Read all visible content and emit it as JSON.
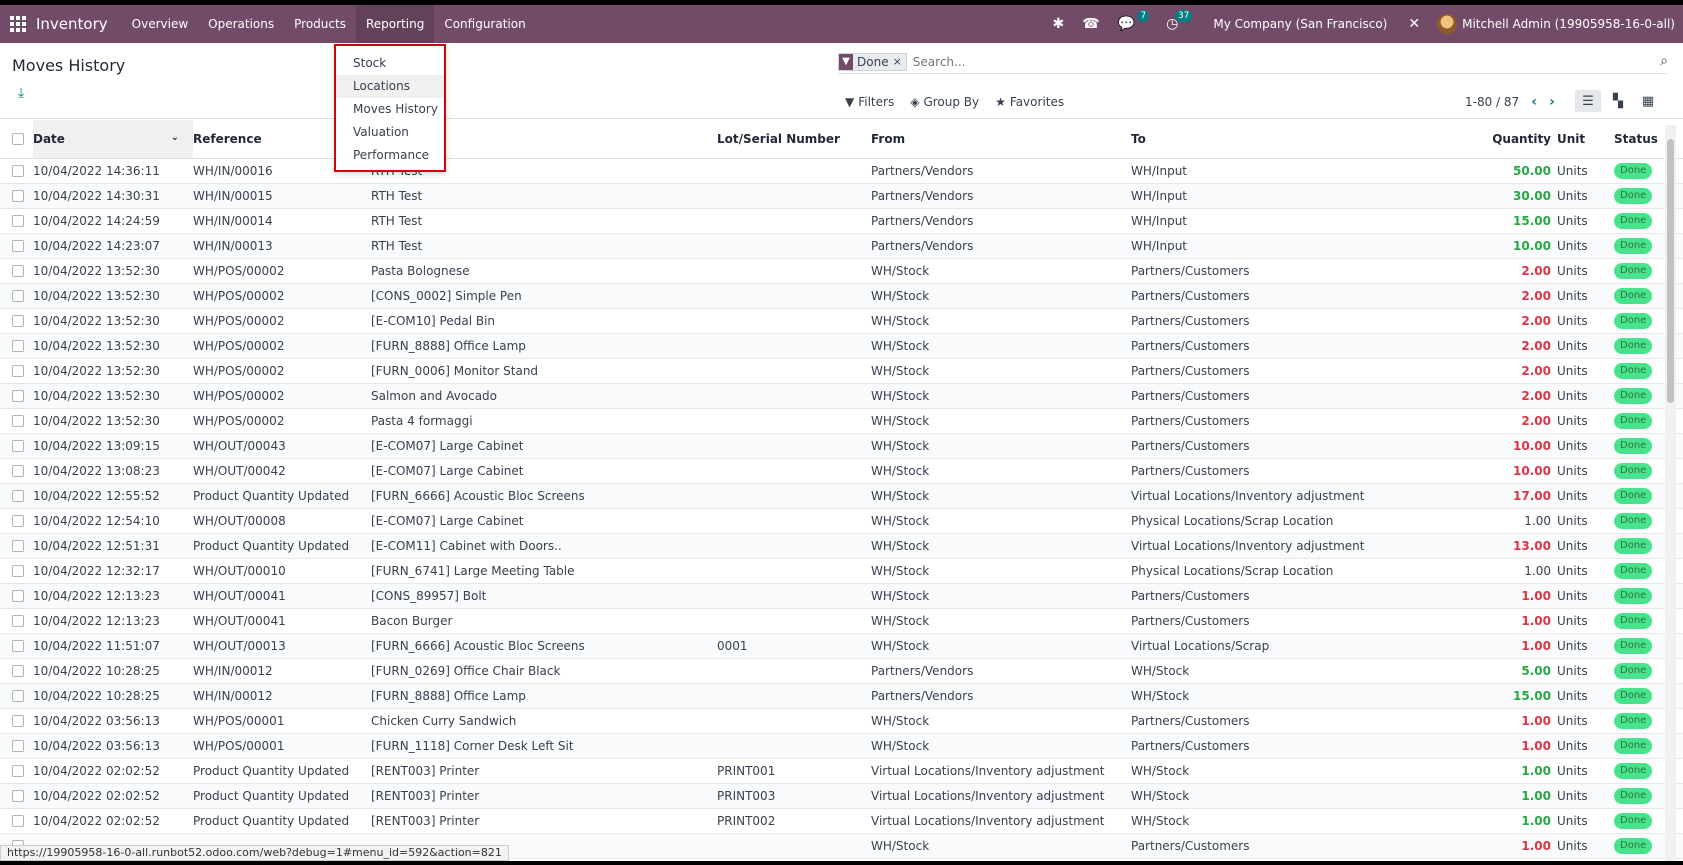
{
  "topbar": {
    "app_name": "Inventory",
    "menus": [
      "Overview",
      "Operations",
      "Products",
      "Reporting",
      "Configuration"
    ],
    "messages_badge": "7",
    "activities_badge": "37",
    "company": "My Company (San Francisco)",
    "user": "Mitchell Admin (19905958-16-0-all)"
  },
  "control_panel": {
    "title": "Moves History",
    "facet": "Done",
    "search_placeholder": "Search...",
    "filters_label": "Filters",
    "groupby_label": "Group By",
    "favorites_label": "Favorites",
    "pager": "1-80 / 87"
  },
  "reporting_menu": {
    "items": [
      "Stock",
      "Locations",
      "Moves History",
      "Valuation",
      "Performance"
    ]
  },
  "table": {
    "headers": {
      "date": "Date",
      "reference": "Reference",
      "product": "",
      "lot": "Lot/Serial Number",
      "from": "From",
      "to": "To",
      "quantity": "Quantity",
      "unit": "Unit",
      "status": "Status"
    },
    "rows": [
      {
        "date": "10/04/2022 14:36:11",
        "reference": "WH/IN/00016",
        "product": "RTH Test",
        "lot": "",
        "from": "Partners/Vendors",
        "to": "WH/Input",
        "quantity": "50.00",
        "qty_color": "green",
        "unit": "Units",
        "status": "Done"
      },
      {
        "date": "10/04/2022 14:30:31",
        "reference": "WH/IN/00015",
        "product": "RTH Test",
        "lot": "",
        "from": "Partners/Vendors",
        "to": "WH/Input",
        "quantity": "30.00",
        "qty_color": "green",
        "unit": "Units",
        "status": "Done"
      },
      {
        "date": "10/04/2022 14:24:59",
        "reference": "WH/IN/00014",
        "product": "RTH Test",
        "lot": "",
        "from": "Partners/Vendors",
        "to": "WH/Input",
        "quantity": "15.00",
        "qty_color": "green",
        "unit": "Units",
        "status": "Done"
      },
      {
        "date": "10/04/2022 14:23:07",
        "reference": "WH/IN/00013",
        "product": "RTH Test",
        "lot": "",
        "from": "Partners/Vendors",
        "to": "WH/Input",
        "quantity": "10.00",
        "qty_color": "green",
        "unit": "Units",
        "status": "Done"
      },
      {
        "date": "10/04/2022 13:52:30",
        "reference": "WH/POS/00002",
        "product": "Pasta Bolognese",
        "lot": "",
        "from": "WH/Stock",
        "to": "Partners/Customers",
        "quantity": "2.00",
        "qty_color": "red",
        "unit": "Units",
        "status": "Done"
      },
      {
        "date": "10/04/2022 13:52:30",
        "reference": "WH/POS/00002",
        "product": "[CONS_0002] Simple Pen",
        "lot": "",
        "from": "WH/Stock",
        "to": "Partners/Customers",
        "quantity": "2.00",
        "qty_color": "red",
        "unit": "Units",
        "status": "Done"
      },
      {
        "date": "10/04/2022 13:52:30",
        "reference": "WH/POS/00002",
        "product": "[E-COM10] Pedal Bin",
        "lot": "",
        "from": "WH/Stock",
        "to": "Partners/Customers",
        "quantity": "2.00",
        "qty_color": "red",
        "unit": "Units",
        "status": "Done"
      },
      {
        "date": "10/04/2022 13:52:30",
        "reference": "WH/POS/00002",
        "product": "[FURN_8888] Office Lamp",
        "lot": "",
        "from": "WH/Stock",
        "to": "Partners/Customers",
        "quantity": "2.00",
        "qty_color": "red",
        "unit": "Units",
        "status": "Done"
      },
      {
        "date": "10/04/2022 13:52:30",
        "reference": "WH/POS/00002",
        "product": "[FURN_0006] Monitor Stand",
        "lot": "",
        "from": "WH/Stock",
        "to": "Partners/Customers",
        "quantity": "2.00",
        "qty_color": "red",
        "unit": "Units",
        "status": "Done"
      },
      {
        "date": "10/04/2022 13:52:30",
        "reference": "WH/POS/00002",
        "product": "Salmon and Avocado",
        "lot": "",
        "from": "WH/Stock",
        "to": "Partners/Customers",
        "quantity": "2.00",
        "qty_color": "red",
        "unit": "Units",
        "status": "Done"
      },
      {
        "date": "10/04/2022 13:52:30",
        "reference": "WH/POS/00002",
        "product": "Pasta 4 formaggi",
        "lot": "",
        "from": "WH/Stock",
        "to": "Partners/Customers",
        "quantity": "2.00",
        "qty_color": "red",
        "unit": "Units",
        "status": "Done"
      },
      {
        "date": "10/04/2022 13:09:15",
        "reference": "WH/OUT/00043",
        "product": "[E-COM07] Large Cabinet",
        "lot": "",
        "from": "WH/Stock",
        "to": "Partners/Customers",
        "quantity": "10.00",
        "qty_color": "red",
        "unit": "Units",
        "status": "Done"
      },
      {
        "date": "10/04/2022 13:08:23",
        "reference": "WH/OUT/00042",
        "product": "[E-COM07] Large Cabinet",
        "lot": "",
        "from": "WH/Stock",
        "to": "Partners/Customers",
        "quantity": "10.00",
        "qty_color": "red",
        "unit": "Units",
        "status": "Done"
      },
      {
        "date": "10/04/2022 12:55:52",
        "reference": "Product Quantity Updated",
        "product": "[FURN_6666] Acoustic Bloc Screens",
        "lot": "",
        "from": "WH/Stock",
        "to": "Virtual Locations/Inventory adjustment",
        "quantity": "17.00",
        "qty_color": "red",
        "unit": "Units",
        "status": "Done"
      },
      {
        "date": "10/04/2022 12:54:10",
        "reference": "WH/OUT/00008",
        "product": "[E-COM07] Large Cabinet",
        "lot": "",
        "from": "WH/Stock",
        "to": "Physical Locations/Scrap Location",
        "quantity": "1.00",
        "qty_color": "plain",
        "unit": "Units",
        "status": "Done"
      },
      {
        "date": "10/04/2022 12:51:31",
        "reference": "Product Quantity Updated",
        "product": "[E-COM11] Cabinet with Doors..",
        "lot": "",
        "from": "WH/Stock",
        "to": "Virtual Locations/Inventory adjustment",
        "quantity": "13.00",
        "qty_color": "red",
        "unit": "Units",
        "status": "Done"
      },
      {
        "date": "10/04/2022 12:32:17",
        "reference": "WH/OUT/00010",
        "product": "[FURN_6741] Large Meeting Table",
        "lot": "",
        "from": "WH/Stock",
        "to": "Physical Locations/Scrap Location",
        "quantity": "1.00",
        "qty_color": "plain",
        "unit": "Units",
        "status": "Done"
      },
      {
        "date": "10/04/2022 12:13:23",
        "reference": "WH/OUT/00041",
        "product": "[CONS_89957] Bolt",
        "lot": "",
        "from": "WH/Stock",
        "to": "Partners/Customers",
        "quantity": "1.00",
        "qty_color": "red",
        "unit": "Units",
        "status": "Done"
      },
      {
        "date": "10/04/2022 12:13:23",
        "reference": "WH/OUT/00041",
        "product": "Bacon Burger",
        "lot": "",
        "from": "WH/Stock",
        "to": "Partners/Customers",
        "quantity": "1.00",
        "qty_color": "red",
        "unit": "Units",
        "status": "Done"
      },
      {
        "date": "10/04/2022 11:51:07",
        "reference": "WH/OUT/00013",
        "product": "[FURN_6666] Acoustic Bloc Screens",
        "lot": "0001",
        "from": "WH/Stock",
        "to": "Virtual Locations/Scrap",
        "quantity": "1.00",
        "qty_color": "red",
        "unit": "Units",
        "status": "Done"
      },
      {
        "date": "10/04/2022 10:28:25",
        "reference": "WH/IN/00012",
        "product": "[FURN_0269] Office Chair Black",
        "lot": "",
        "from": "Partners/Vendors",
        "to": "WH/Stock",
        "quantity": "5.00",
        "qty_color": "green",
        "unit": "Units",
        "status": "Done"
      },
      {
        "date": "10/04/2022 10:28:25",
        "reference": "WH/IN/00012",
        "product": "[FURN_8888] Office Lamp",
        "lot": "",
        "from": "Partners/Vendors",
        "to": "WH/Stock",
        "quantity": "15.00",
        "qty_color": "green",
        "unit": "Units",
        "status": "Done"
      },
      {
        "date": "10/04/2022 03:56:13",
        "reference": "WH/POS/00001",
        "product": "Chicken Curry Sandwich",
        "lot": "",
        "from": "WH/Stock",
        "to": "Partners/Customers",
        "quantity": "1.00",
        "qty_color": "red",
        "unit": "Units",
        "status": "Done"
      },
      {
        "date": "10/04/2022 03:56:13",
        "reference": "WH/POS/00001",
        "product": "[FURN_1118] Corner Desk Left Sit",
        "lot": "",
        "from": "WH/Stock",
        "to": "Partners/Customers",
        "quantity": "1.00",
        "qty_color": "red",
        "unit": "Units",
        "status": "Done"
      },
      {
        "date": "10/04/2022 02:02:52",
        "reference": "Product Quantity Updated",
        "product": "[RENT003] Printer",
        "lot": "PRINT001",
        "from": "Virtual Locations/Inventory adjustment",
        "to": "WH/Stock",
        "quantity": "1.00",
        "qty_color": "green",
        "unit": "Units",
        "status": "Done"
      },
      {
        "date": "10/04/2022 02:02:52",
        "reference": "Product Quantity Updated",
        "product": "[RENT003] Printer",
        "lot": "PRINT003",
        "from": "Virtual Locations/Inventory adjustment",
        "to": "WH/Stock",
        "quantity": "1.00",
        "qty_color": "green",
        "unit": "Units",
        "status": "Done"
      },
      {
        "date": "10/04/2022 02:02:52",
        "reference": "Product Quantity Updated",
        "product": "[RENT003] Printer",
        "lot": "PRINT002",
        "from": "Virtual Locations/Inventory adjustment",
        "to": "WH/Stock",
        "quantity": "1.00",
        "qty_color": "green",
        "unit": "Units",
        "status": "Done"
      },
      {
        "date": "",
        "reference": "",
        "product": "",
        "lot": "",
        "from": "WH/Stock",
        "to": "Partners/Customers",
        "quantity": "1.00",
        "qty_color": "red",
        "unit": "Units",
        "status": "Done"
      }
    ]
  },
  "statusbar": {
    "url": "https://19905958-16-0-all.runbot52.odoo.com/web?debug=1#menu_id=592&action=821"
  },
  "colors": {
    "brand": "#714B67",
    "accent": "#017e84",
    "highlight_border": "#d1020c",
    "done_badge": "#28e077"
  }
}
